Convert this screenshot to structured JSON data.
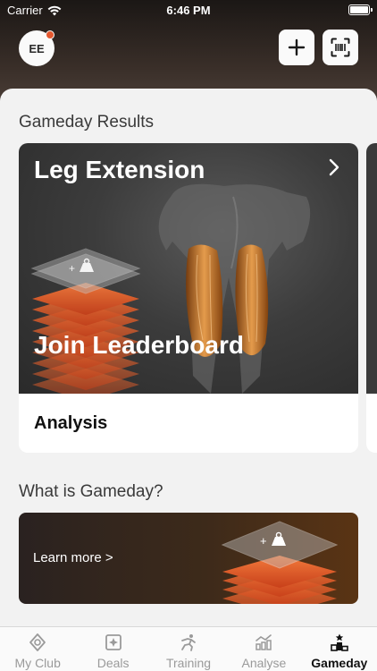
{
  "status_bar": {
    "carrier": "Carrier",
    "time": "6:46 PM"
  },
  "header": {
    "avatar_initials": "EE"
  },
  "gameday": {
    "section_title": "Gameday Results",
    "card": {
      "title": "Leg Extension",
      "cta": "Join Leaderboard",
      "footer": "Analysis"
    }
  },
  "about": {
    "section_title": "What is Gameday?",
    "learn_more": "Learn more >"
  },
  "tabs": [
    {
      "label": "My Club",
      "icon": "location-pin-icon",
      "active": false
    },
    {
      "label": "Deals",
      "icon": "deals-icon",
      "active": false
    },
    {
      "label": "Training",
      "icon": "running-figure-icon",
      "active": false
    },
    {
      "label": "Analyse",
      "icon": "bar-chart-icon",
      "active": false
    },
    {
      "label": "Gameday",
      "icon": "podium-icon",
      "active": true
    }
  ],
  "colors": {
    "accent": "#e4572e",
    "orange_layers": "#e8561e"
  }
}
